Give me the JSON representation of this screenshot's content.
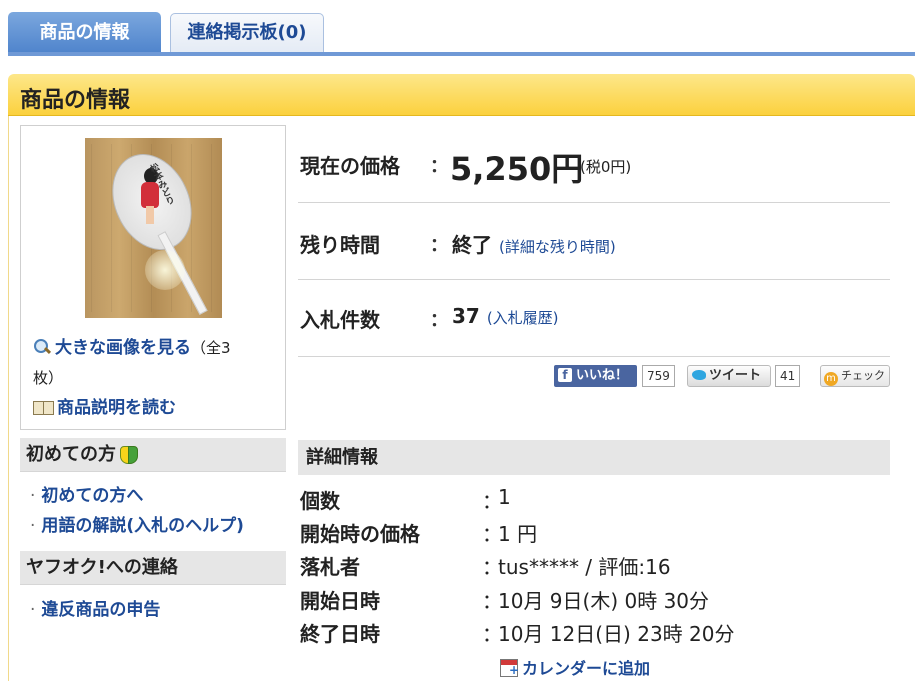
{
  "tabs": {
    "item_info": "商品の情報",
    "bulletin": "連絡掲示板(0)"
  },
  "section": {
    "title": "商品の情報"
  },
  "image_panel": {
    "view_large": "大きな画像を見る",
    "count_note_part1": "（全3",
    "count_note_part2": "枚）",
    "read_description": "商品説明を読む",
    "fan_text": "松本みどり"
  },
  "sidebar": {
    "beginners": {
      "title": "初めての方",
      "items": [
        "初めての方へ",
        "用語の解説(入札のヘルプ)"
      ]
    },
    "contact": {
      "title": "ヤフオク!への連絡",
      "items": [
        "違反商品の申告"
      ]
    }
  },
  "info": {
    "price": {
      "label": "現在の価格",
      "colon": "：",
      "value": "5,250円",
      "tax": "(税0円)"
    },
    "time_left": {
      "label": "残り時間",
      "colon": "：",
      "value": "終了",
      "link": "(詳細な残り時間)"
    },
    "bids": {
      "label": "入札件数",
      "colon": "：",
      "value": "37",
      "link": "(入札履歴)"
    }
  },
  "social": {
    "like_label": "いいね！",
    "like_count": "759",
    "tweet_label": "ツイート",
    "tweet_count": "41",
    "check_label": "チェック",
    "colors": {
      "facebook": "#4a65a0",
      "twitter": "#2fa6e0",
      "check": "#f0a824"
    }
  },
  "details": {
    "title": "詳細情報",
    "rows": [
      {
        "label": "個数",
        "value": "1"
      },
      {
        "label": "開始時の価格",
        "value": "1 円"
      },
      {
        "label": "落札者",
        "value": "tus***** / 評価:16"
      },
      {
        "label": "開始日時",
        "value": "10月 9日(木) 0時 30分"
      },
      {
        "label": "終了日時",
        "value": "10月 12日(日) 23時 20分"
      }
    ],
    "colon": "：",
    "calendar_link": "カレンダーに追加"
  },
  "colors": {
    "tab_active": "#4f84cc",
    "header_yellow": "#fbd13e",
    "link_blue": "#1e4a95"
  }
}
